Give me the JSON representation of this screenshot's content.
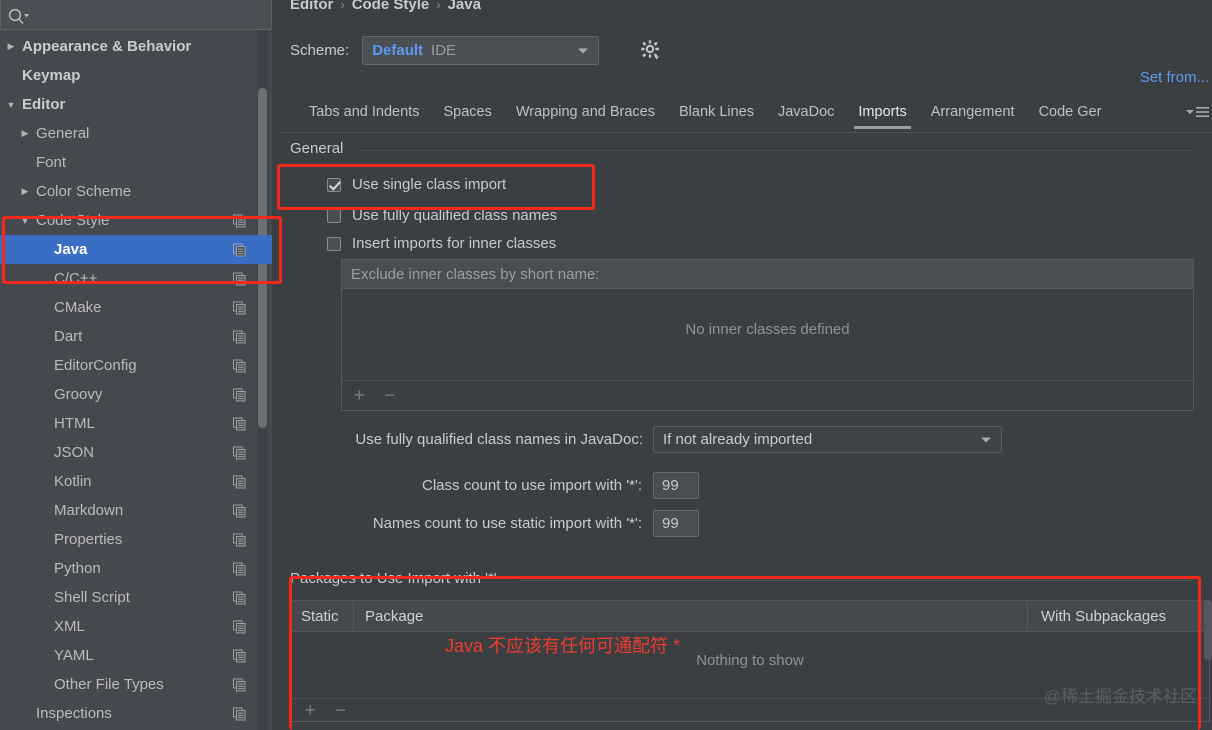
{
  "search": {
    "placeholder": "",
    "value": "",
    "icon": "search-icon"
  },
  "sidebar": {
    "items": [
      {
        "label": "Appearance & Behavior",
        "level": 0,
        "arrow": "right",
        "selected": false,
        "copy": false
      },
      {
        "label": "Keymap",
        "level": 0,
        "arrow": "",
        "selected": false,
        "copy": false
      },
      {
        "label": "Editor",
        "level": 0,
        "arrow": "down",
        "selected": false,
        "copy": false
      },
      {
        "label": "General",
        "level": 1,
        "arrow": "right",
        "selected": false,
        "copy": false
      },
      {
        "label": "Font",
        "level": 1,
        "arrow": "",
        "selected": false,
        "copy": false
      },
      {
        "label": "Color Scheme",
        "level": 1,
        "arrow": "right",
        "selected": false,
        "copy": false
      },
      {
        "label": "Code Style",
        "level": 1,
        "arrow": "down",
        "selected": false,
        "copy": true
      },
      {
        "label": "Java",
        "level": 2,
        "arrow": "",
        "selected": true,
        "copy": true
      },
      {
        "label": "C/C++",
        "level": 2,
        "arrow": "",
        "selected": false,
        "copy": true
      },
      {
        "label": "CMake",
        "level": 2,
        "arrow": "",
        "selected": false,
        "copy": true
      },
      {
        "label": "Dart",
        "level": 2,
        "arrow": "",
        "selected": false,
        "copy": true
      },
      {
        "label": "EditorConfig",
        "level": 2,
        "arrow": "",
        "selected": false,
        "copy": true
      },
      {
        "label": "Groovy",
        "level": 2,
        "arrow": "",
        "selected": false,
        "copy": true
      },
      {
        "label": "HTML",
        "level": 2,
        "arrow": "",
        "selected": false,
        "copy": true
      },
      {
        "label": "JSON",
        "level": 2,
        "arrow": "",
        "selected": false,
        "copy": true
      },
      {
        "label": "Kotlin",
        "level": 2,
        "arrow": "",
        "selected": false,
        "copy": true
      },
      {
        "label": "Markdown",
        "level": 2,
        "arrow": "",
        "selected": false,
        "copy": true
      },
      {
        "label": "Properties",
        "level": 2,
        "arrow": "",
        "selected": false,
        "copy": true
      },
      {
        "label": "Python",
        "level": 2,
        "arrow": "",
        "selected": false,
        "copy": true
      },
      {
        "label": "Shell Script",
        "level": 2,
        "arrow": "",
        "selected": false,
        "copy": true
      },
      {
        "label": "XML",
        "level": 2,
        "arrow": "",
        "selected": false,
        "copy": true
      },
      {
        "label": "YAML",
        "level": 2,
        "arrow": "",
        "selected": false,
        "copy": true
      },
      {
        "label": "Other File Types",
        "level": 2,
        "arrow": "",
        "selected": false,
        "copy": true
      },
      {
        "label": "Inspections",
        "level": 1,
        "arrow": "",
        "selected": false,
        "copy": true
      }
    ]
  },
  "breadcrumb": {
    "part1": "Editor",
    "sep1": "›",
    "part2": "Code Style",
    "sep2": "›",
    "part3": "Java"
  },
  "scheme": {
    "label": "Scheme:",
    "value": "Default",
    "suffix": "IDE",
    "gear_icon": "gear-icon"
  },
  "set_from": {
    "label": "Set from..."
  },
  "tabs": [
    {
      "label": "Tabs and Indents",
      "active": false
    },
    {
      "label": "Spaces",
      "active": false
    },
    {
      "label": "Wrapping and Braces",
      "active": false
    },
    {
      "label": "Blank Lines",
      "active": false
    },
    {
      "label": "JavaDoc",
      "active": false
    },
    {
      "label": "Imports",
      "active": true
    },
    {
      "label": "Arrangement",
      "active": false
    },
    {
      "label": "Code Ger",
      "active": false
    }
  ],
  "general": {
    "title": "General",
    "checkboxes": [
      {
        "label": "Use single class import",
        "checked": true
      },
      {
        "label": "Use fully qualified class names",
        "checked": false
      },
      {
        "label": "Insert imports for inner classes",
        "checked": false
      }
    ]
  },
  "exclude_panel": {
    "header": "Exclude inner classes by short name:",
    "empty_text": "No inner classes defined",
    "add_label": "+",
    "remove_label": "−"
  },
  "javadoc": {
    "label": "Use fully qualified class names in JavaDoc:",
    "value": "If not already imported"
  },
  "counts": [
    {
      "label": "Class count to use import with '*':",
      "value": "99"
    },
    {
      "label": "Names count to use static import with '*':",
      "value": "99"
    }
  ],
  "packages": {
    "title": "Packages to Use Import with '*'",
    "columns": [
      "Static",
      "Package",
      "With Subpackages"
    ],
    "rows": [],
    "empty_text": "Nothing to show",
    "add_label": "+",
    "remove_label": "−"
  },
  "annotation": {
    "text": "Java 不应该有任何可通配符 *",
    "color": "#ef3b2d"
  },
  "watermark": {
    "text": "@稀土掘金技术社区"
  },
  "colors": {
    "sidebar_bg": "#45484f",
    "main_bg": "#3c3f41",
    "selection": "#3a6ec5",
    "link": "#5b9bf0",
    "annotation_red": "#f4291b",
    "text": "#c7cbcf"
  }
}
